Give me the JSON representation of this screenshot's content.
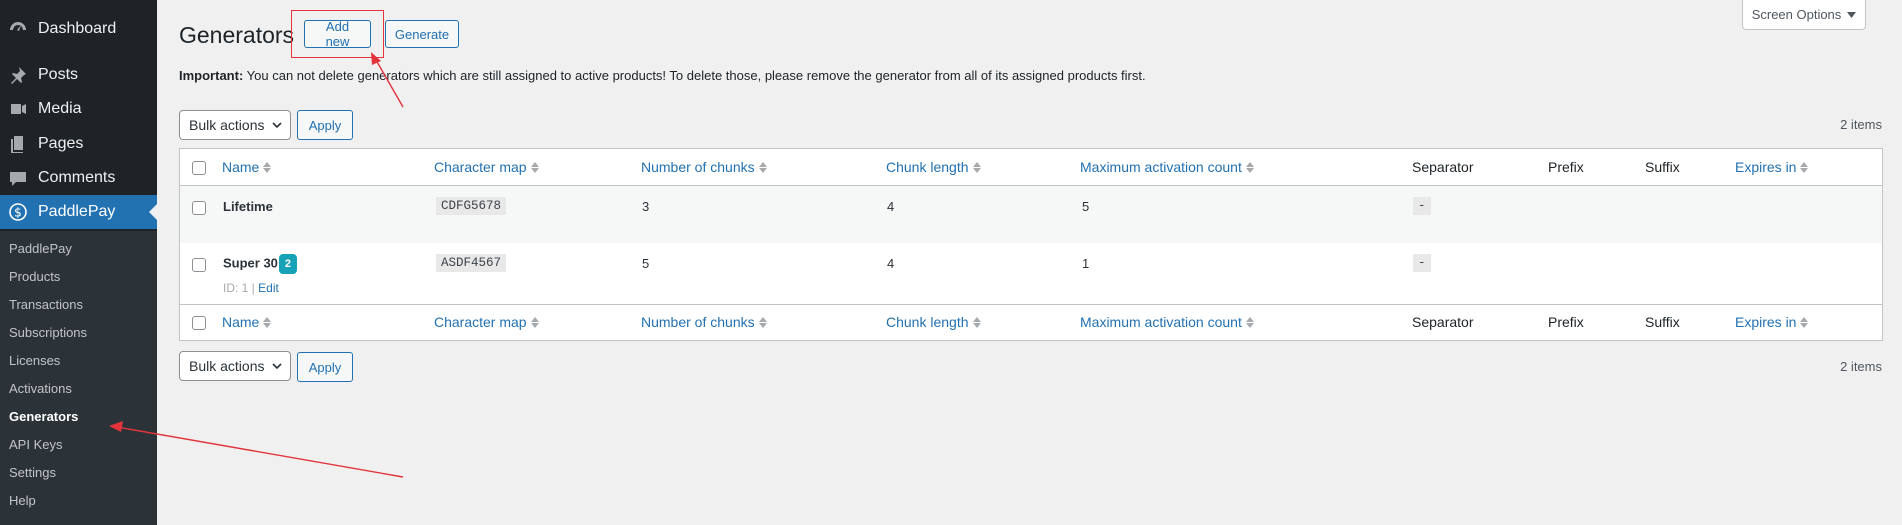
{
  "sidebar": {
    "top_items": [
      {
        "label": "Dashboard",
        "icon": "dashboard-icon"
      },
      {
        "label": "Posts",
        "icon": "pin-icon"
      },
      {
        "label": "Media",
        "icon": "media-icon"
      },
      {
        "label": "Pages",
        "icon": "pages-icon"
      },
      {
        "label": "Comments",
        "icon": "comment-icon"
      },
      {
        "label": "PaddlePay",
        "icon": "dollar-icon",
        "current": true
      }
    ],
    "submenu": [
      "PaddlePay",
      "Products",
      "Transactions",
      "Subscriptions",
      "Licenses",
      "Activations",
      "Generators",
      "API Keys",
      "Settings",
      "Help"
    ],
    "current_submenu": "Generators"
  },
  "header": {
    "title": "Generators",
    "add_new_label": "Add new",
    "generate_label": "Generate",
    "screen_options_label": "Screen Options"
  },
  "notice": {
    "strong": "Important:",
    "text": " You can not delete generators which are still assigned to active products! To delete those, please remove the generator from all of its assigned products first."
  },
  "bulk_actions": {
    "label": "Bulk actions",
    "apply_label": "Apply",
    "items_count": "2 items"
  },
  "table": {
    "columns": [
      {
        "label": "Name",
        "sortable": true
      },
      {
        "label": "Character map",
        "sortable": true
      },
      {
        "label": "Number of chunks",
        "sortable": true
      },
      {
        "label": "Chunk length",
        "sortable": true
      },
      {
        "label": "Maximum activation count",
        "sortable": true
      },
      {
        "label": "Separator",
        "sortable": false
      },
      {
        "label": "Prefix",
        "sortable": false
      },
      {
        "label": "Suffix",
        "sortable": false
      },
      {
        "label": "Expires in",
        "sortable": true
      }
    ],
    "rows": [
      {
        "name": "Lifetime",
        "badge": "",
        "character_map": "CDFG5678",
        "number_of_chunks": "3",
        "chunk_length": "4",
        "max_activation_count": "5",
        "separator": "-",
        "prefix": "",
        "suffix": "",
        "expires_in": ""
      },
      {
        "name": "Super 30",
        "badge": "2",
        "meta_id": "ID: 1",
        "meta_sep": " | ",
        "meta_edit": "Edit",
        "character_map": "ASDF4567",
        "number_of_chunks": "5",
        "chunk_length": "4",
        "max_activation_count": "1",
        "separator": "-",
        "prefix": "",
        "suffix": "",
        "expires_in": ""
      }
    ]
  },
  "colors": {
    "admin_bar": "#1d2327",
    "accent": "#2271b1",
    "badge": "#17a2b8",
    "annotation": "#e3343b"
  }
}
